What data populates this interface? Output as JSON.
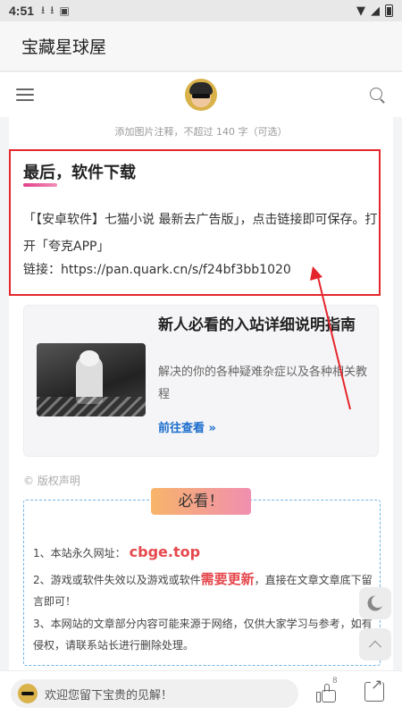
{
  "status_bar": {
    "time": "4:51",
    "notif_icons": [
      "download-icon",
      "download-icon",
      "app-a-icon"
    ],
    "right_icons": [
      "wifi-icon",
      "signal-icon",
      "battery-icon"
    ]
  },
  "app_bar": {
    "title": "宝藏星球屋"
  },
  "web_nav": {
    "menu_icon": "hamburger-icon",
    "avatar": "avatar-image",
    "search_icon": "search-icon"
  },
  "content": {
    "caption": "添加图片注释，不超过 140 字（可选）",
    "section_title": "最后，软件下载",
    "paragraph": "「【安卓软件】七猫小说 最新去广告版」，点击链接即可保存。打开「夸克APP」",
    "link_prefix": "链接：",
    "link_url": "https://pan.quark.cn/s/f24bf3bb1020",
    "annotation_color": "#e4262c"
  },
  "promo_card": {
    "title": "新人必看的入站详细说明指南",
    "description": "解决的你的各种疑难杂症以及各种相关教程",
    "cta": "前往查看 »"
  },
  "copyright": "© 版权声明",
  "notice": {
    "badge": "必看！",
    "line1_prefix": "1、本站永久网址：",
    "line1_domain": "cbge.top",
    "line2_prefix": "2、游戏或软件失效以及游戏或软件",
    "line2_highlight": "需要更新",
    "line2_suffix": "，直接在文章文章底下留言即可！",
    "line3": "3、本网站的文章部分内容可能来源于网络，仅供大家学习与参考，如有侵权，请联系站长进行删除处理。"
  },
  "floating": {
    "dark_mode_icon": "moon-icon",
    "top_icon": "chevron-up-icon"
  },
  "bottom_bar": {
    "comment_placeholder": "欢迎您留下宝贵的见解！",
    "like_count": "8",
    "like_icon": "thumbs-up-icon",
    "share_icon": "share-icon"
  }
}
